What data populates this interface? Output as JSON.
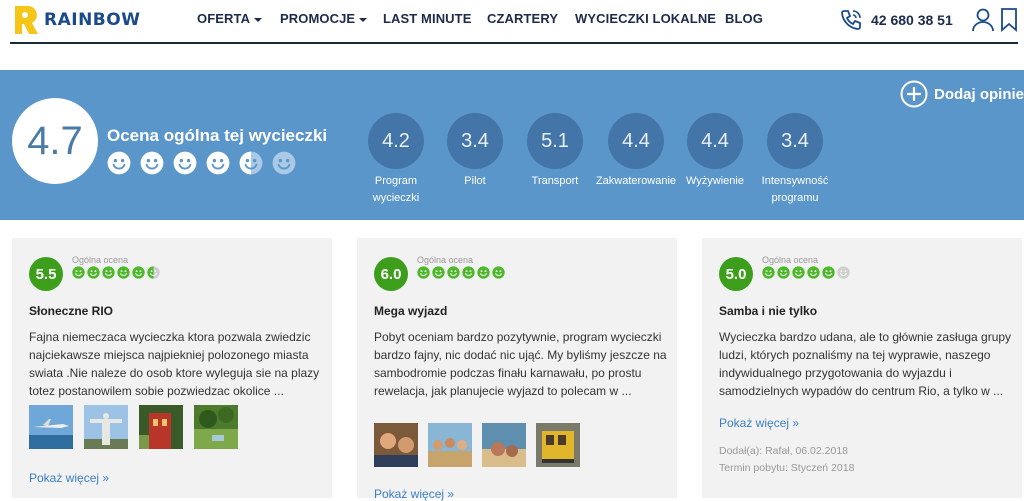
{
  "brand": {
    "name": "RAINBOW",
    "color": "#1a4a8a",
    "accent": "#f5c518"
  },
  "nav": [
    {
      "label": "OFERTA",
      "caret": true
    },
    {
      "label": "PROMOCJE",
      "caret": true
    },
    {
      "label": "LAST MINUTE",
      "caret": false
    },
    {
      "label": "CZARTERY",
      "caret": false
    },
    {
      "label": "WYCIECZKI LOKALNE",
      "caret": false
    },
    {
      "label": "BLOG",
      "caret": false
    }
  ],
  "phone": {
    "number": "42 680 38 51",
    "icon": "phone-icon"
  },
  "header_icons": [
    "user-icon",
    "bookmark-icon"
  ],
  "rating": {
    "overall": "4.7",
    "label": "Ocena ogólna tej wycieczki",
    "faces_filled": 4,
    "faces_half": 1,
    "faces_total": 6,
    "add_opinion": "Dodaj opinie",
    "categories": [
      {
        "value": "4.2",
        "label": "Program wycieczki"
      },
      {
        "value": "3.4",
        "label": "Pilot"
      },
      {
        "value": "5.1",
        "label": "Transport"
      },
      {
        "value": "4.4",
        "label": "Zakwaterowanie"
      },
      {
        "value": "4.4",
        "label": "Wyżywienie"
      },
      {
        "value": "3.4",
        "label": "Intensywność programu"
      }
    ]
  },
  "colors": {
    "hero": "#5b96cb",
    "circle": "#4375a8",
    "score_green": "#3d9e1b",
    "face_green": "#4cb82a",
    "link": "#3b7fc4"
  },
  "reviews": [
    {
      "score": "5.5",
      "ogolna": "Ogólna ocena",
      "faces_filled": 5,
      "faces_half": 1,
      "title": "Słoneczne RIO",
      "text": "Fajna niemeczaca wycieczka ktora pozwala zwiedzic najciekawsze miejsca najpiekniej polozonego miasta swiata .Nie naleze do osob ktore wyleguja sie na plazy totez postanowilem sobie pozwiedzac okolice ...",
      "photos": [
        "seaplane-photo",
        "christ-statue-photo",
        "red-building-photo",
        "garden-photo"
      ],
      "more": "Pokaż więcej »"
    },
    {
      "score": "6.0",
      "ogolna": "Ogólna ocena",
      "faces_filled": 6,
      "faces_half": 0,
      "title": "Mega wyjazd",
      "text": "Pobyt oceniam bardzo pozytywnie, program wycieczki bardzo fajny, nic dodać nic ująć. My byliśmy jeszcze na sambodromie podczas finału karnawału, po prostu rewelacja, jak planujecie wyjazd to polecam w ...",
      "photos": [
        "people-photo",
        "group-photo",
        "beach-photo",
        "tram-photo"
      ],
      "more": "Pokaż więcej »"
    },
    {
      "score": "5.0",
      "ogolna": "Ogólna ocena",
      "faces_filled": 5,
      "faces_half": 0,
      "title": "Samba i nie tylko",
      "text": "Wycieczka bardzo udana, ale to głównie zasługa grupy ludzi, których poznaliśmy na tej wyprawie, naszego indywidualnego przygotowania do wyjazdu i samodzielnych wypadów do centrum Rio, a tylko w ...",
      "photos": [],
      "more": "Pokaż więcej »",
      "added": "Dodał(a): Rafał, 06.02.2018",
      "stay": "Termin pobytu: Styczeń 2018"
    }
  ]
}
